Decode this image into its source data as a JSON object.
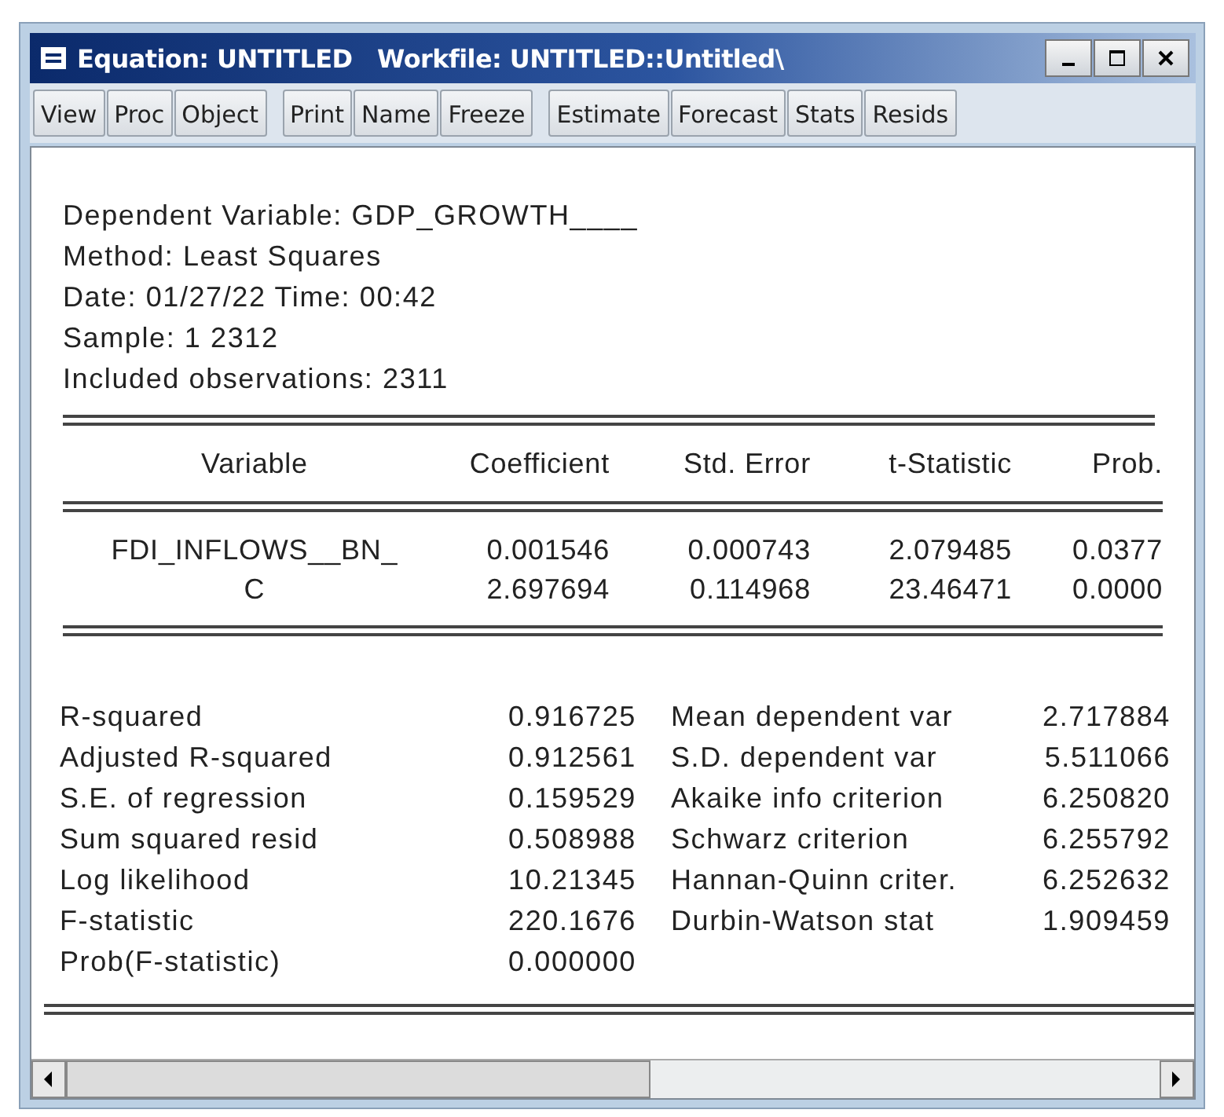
{
  "window": {
    "title": "Equation: UNTITLED   Workfile: UNTITLED::Untitled\\"
  },
  "toolbar": [
    [
      "View",
      "Proc",
      "Object"
    ],
    [
      "Print",
      "Name",
      "Freeze"
    ],
    [
      "Estimate",
      "Forecast",
      "Stats",
      "Resids"
    ]
  ],
  "header_lines": [
    "Dependent Variable: GDP_GROWTH____",
    "Method: Least Squares",
    "Date: 01/27/22   Time: 00:42",
    "Sample: 1 2312",
    "Included observations: 2311"
  ],
  "table": {
    "columns": [
      "Variable",
      "Coefficient",
      "Std. Error",
      "t-Statistic",
      "Prob."
    ],
    "rows": [
      [
        "FDI_INFLOWS__BN_",
        "0.001546",
        "0.000743",
        "2.079485",
        "0.0377"
      ],
      [
        "C",
        "2.697694",
        "0.114968",
        "23.46471",
        "0.0000"
      ]
    ]
  },
  "statistics": [
    {
      "label": "R-squared",
      "value": "0.916725",
      "label_2": "Mean dependent var",
      "value_2": "2.717884"
    },
    {
      "label": "Adjusted R-squared",
      "value": "0.912561",
      "label_2": "S.D. dependent var",
      "value_2": "5.511066"
    },
    {
      "label": "S.E. of regression",
      "value": "0.159529",
      "label_2": "Akaike info criterion",
      "value_2": "6.250820"
    },
    {
      "label": "Sum squared resid",
      "value": "0.508988",
      "label_2": "Schwarz criterion",
      "value_2": "6.255792"
    },
    {
      "label": "Log likelihood",
      "value": "10.21345",
      "label_2": "Hannan-Quinn criter.",
      "value_2": "6.252632"
    },
    {
      "label": "F-statistic",
      "value": "220.1676",
      "label_2": "Durbin-Watson stat",
      "value_2": "1.909459"
    },
    {
      "label": "Prob(F-statistic)",
      "value": "0.000000"
    }
  ]
}
